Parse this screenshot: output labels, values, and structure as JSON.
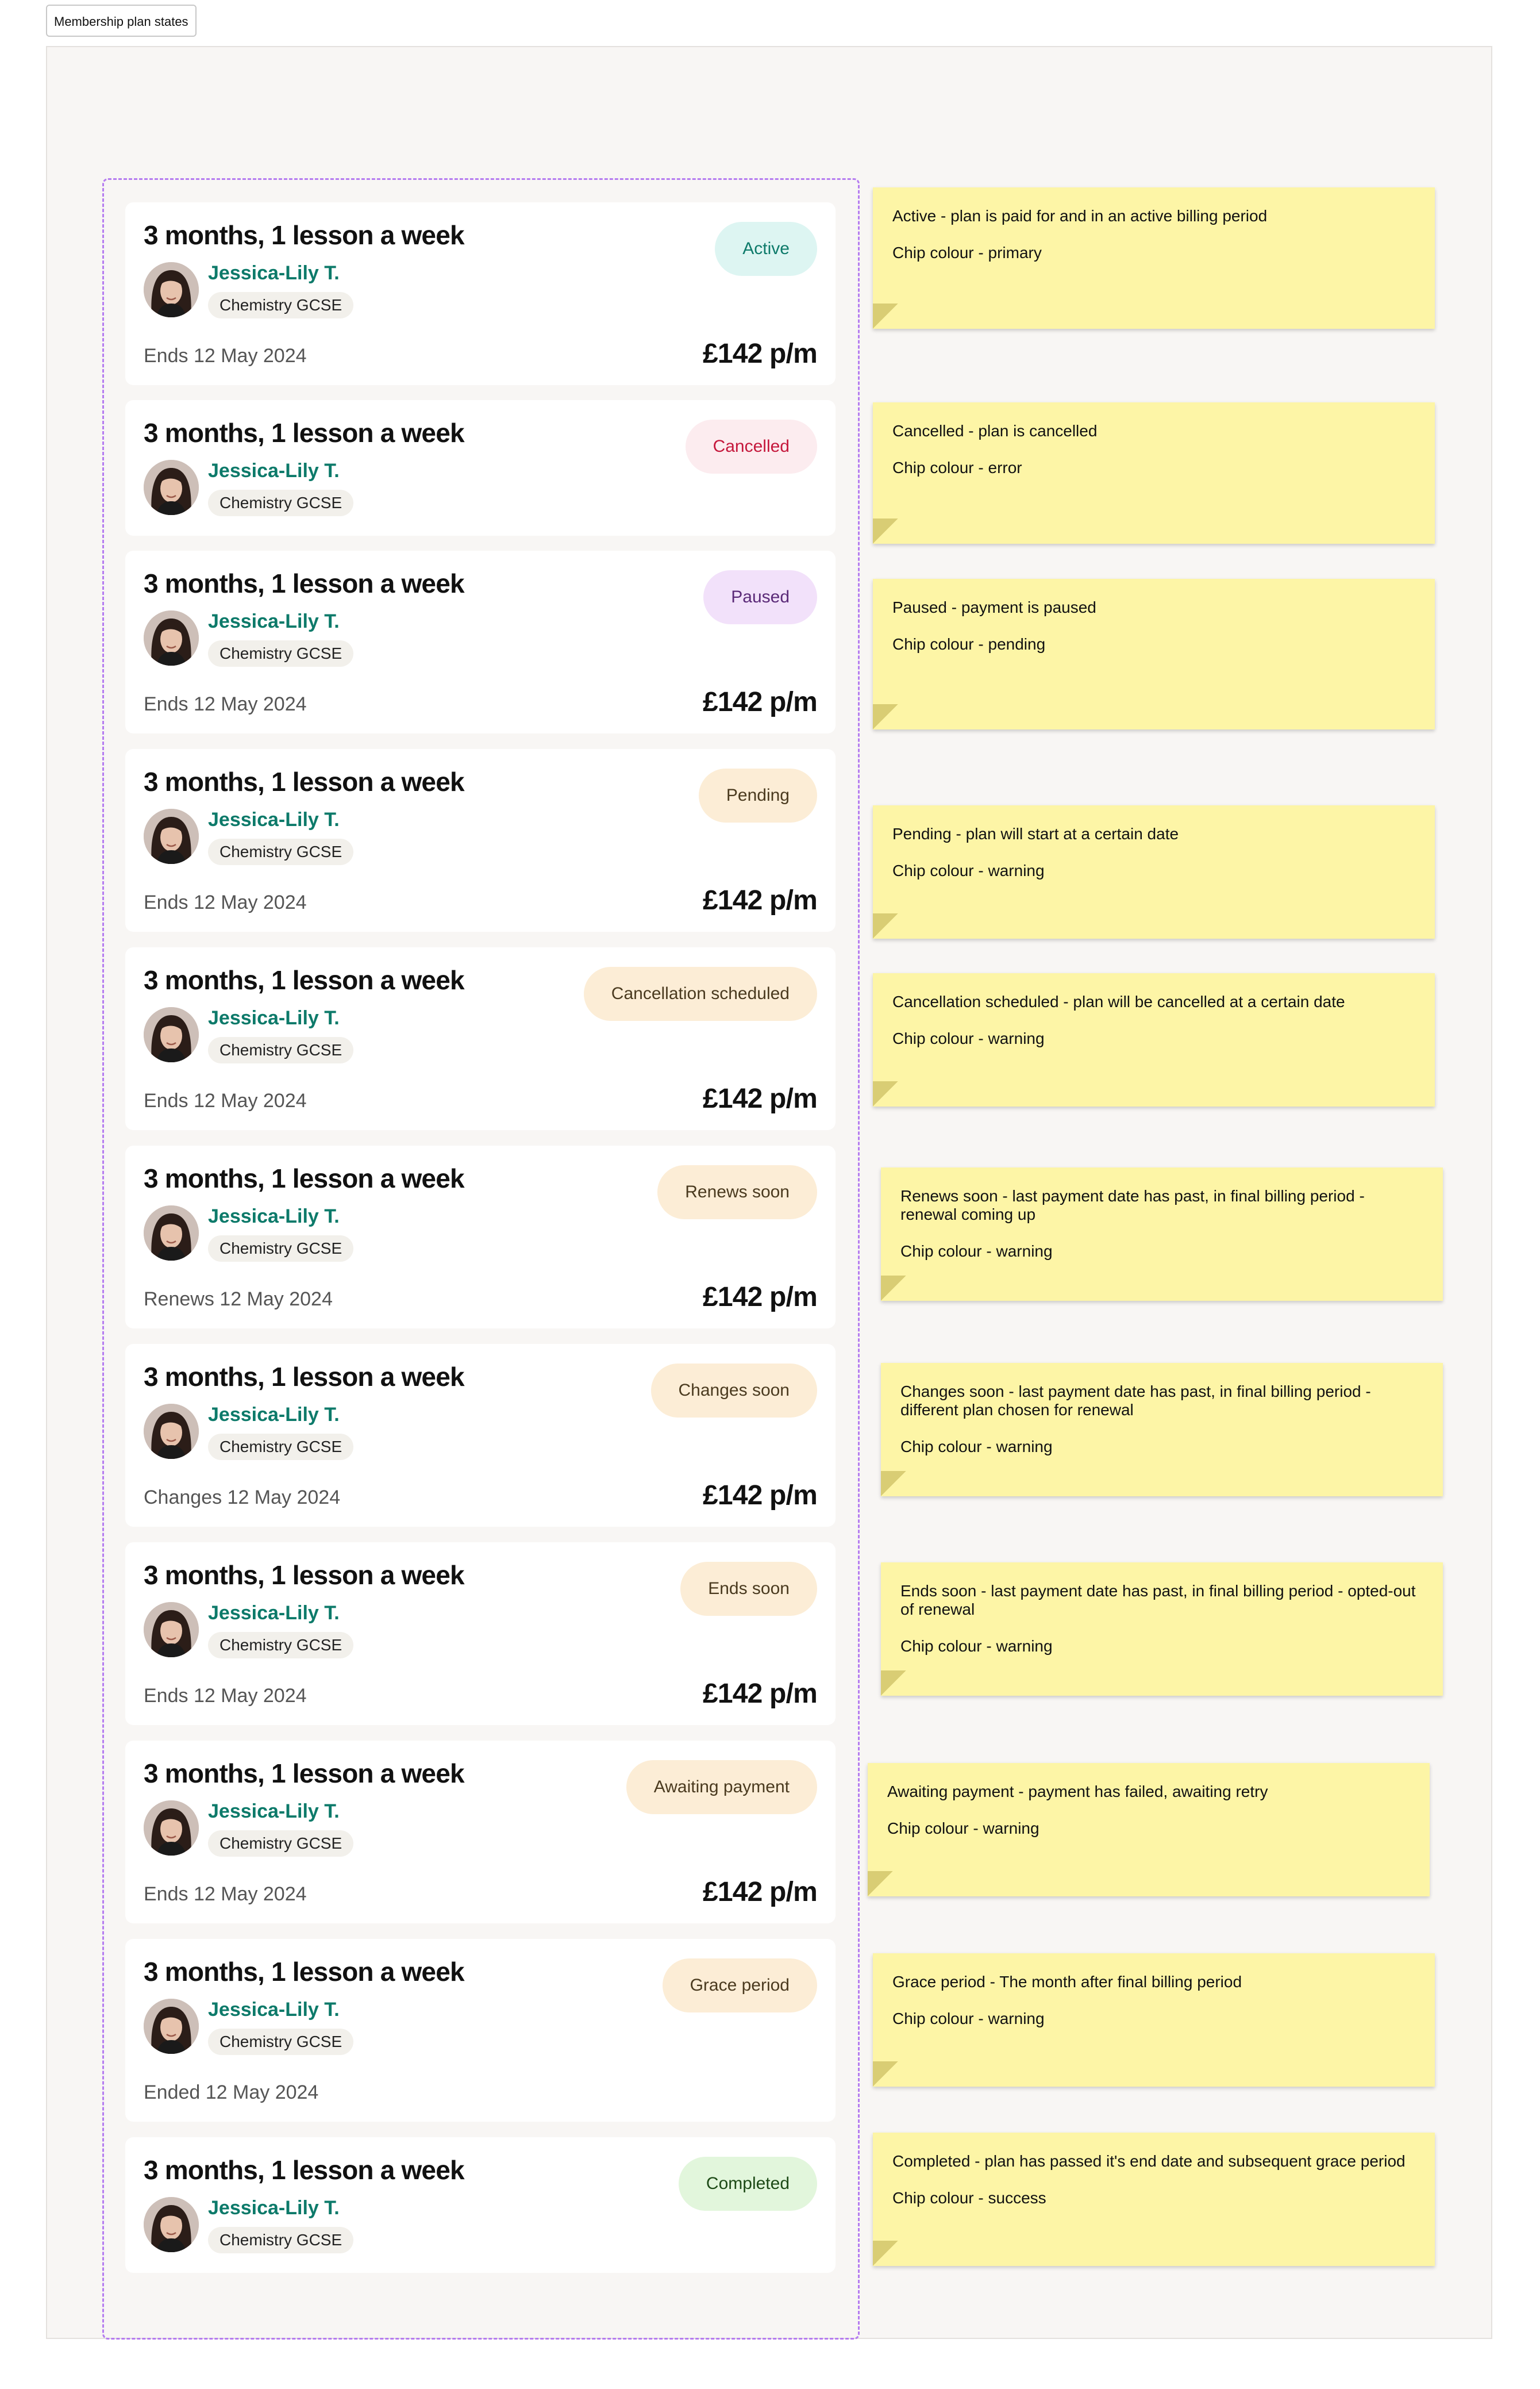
{
  "frame": {
    "label": "Membership plan states"
  },
  "colors": {
    "canvas_bg": "#f8f6f4",
    "dashed_border": "#b57cf0",
    "tutor_name": "#0d7a6a",
    "sticky_note": "#fdf5a6",
    "chip_primary": "#ddf5f2",
    "chip_error": "#fcecef",
    "chip_pending": "#f2e1fa",
    "chip_warning": "#fcedd6",
    "chip_success": "#e2f6dc"
  },
  "cards": [
    {
      "title": "3 months, 1 lesson a week",
      "tutor": "Jessica-Lily T.",
      "subject": "Chemistry GCSE",
      "status": "Active",
      "chip_color": "primary",
      "end_text": "Ends 12 May 2024",
      "price": "£142 p/m"
    },
    {
      "title": "3 months, 1 lesson a week",
      "tutor": "Jessica-Lily T.",
      "subject": "Chemistry GCSE",
      "status": "Cancelled",
      "chip_color": "error"
    },
    {
      "title": "3 months, 1 lesson a week",
      "tutor": "Jessica-Lily T.",
      "subject": "Chemistry GCSE",
      "status": "Paused",
      "chip_color": "pending",
      "end_text": "Ends 12 May 2024",
      "price": "£142 p/m"
    },
    {
      "title": "3 months, 1 lesson a week",
      "tutor": "Jessica-Lily T.",
      "subject": "Chemistry GCSE",
      "status": "Pending",
      "chip_color": "warning",
      "end_text": "Ends 12 May 2024",
      "price": "£142 p/m"
    },
    {
      "title": "3 months, 1 lesson a week",
      "tutor": "Jessica-Lily T.",
      "subject": "Chemistry GCSE",
      "status": "Cancellation scheduled",
      "chip_color": "warning",
      "end_text": "Ends 12 May 2024",
      "price": "£142 p/m"
    },
    {
      "title": "3 months, 1 lesson a week",
      "tutor": "Jessica-Lily T.",
      "subject": "Chemistry GCSE",
      "status": "Renews soon",
      "chip_color": "warning",
      "end_text": "Renews 12 May 2024",
      "price": "£142 p/m"
    },
    {
      "title": "3 months, 1 lesson a week",
      "tutor": "Jessica-Lily T.",
      "subject": "Chemistry GCSE",
      "status": "Changes soon",
      "chip_color": "warning",
      "end_text": "Changes 12 May 2024",
      "price": "£142 p/m"
    },
    {
      "title": "3 months, 1 lesson a week",
      "tutor": "Jessica-Lily T.",
      "subject": "Chemistry GCSE",
      "status": "Ends soon",
      "chip_color": "warning",
      "end_text": "Ends 12 May 2024",
      "price": "£142 p/m"
    },
    {
      "title": "3 months, 1 lesson a week",
      "tutor": "Jessica-Lily T.",
      "subject": "Chemistry GCSE",
      "status": "Awaiting payment",
      "chip_color": "warning",
      "end_text": "Ends 12 May 2024",
      "price": "£142 p/m"
    },
    {
      "title": "3 months, 1 lesson a week",
      "tutor": "Jessica-Lily T.",
      "subject": "Chemistry GCSE",
      "status": "Grace period",
      "chip_color": "warning",
      "end_text": "Ended 12 May 2024"
    },
    {
      "title": "3 months, 1 lesson a week",
      "tutor": "Jessica-Lily T.",
      "subject": "Chemistry GCSE",
      "status": "Completed",
      "chip_color": "success"
    }
  ],
  "notes": [
    {
      "description": "Active - plan is paid for and in an active billing period",
      "chip_text": "Chip colour - primary"
    },
    {
      "description": "Cancelled - plan is cancelled",
      "chip_text": "Chip colour - error"
    },
    {
      "description": "Paused - payment is paused",
      "chip_text": "Chip colour - pending"
    },
    {
      "description": "Pending - plan will start at a certain date",
      "chip_text": "Chip colour - warning"
    },
    {
      "description": "Cancellation scheduled - plan will be cancelled at a certain date",
      "chip_text": "Chip colour - warning"
    },
    {
      "description": "Renews soon - last payment date has past, in final billing period - renewal coming up",
      "chip_text": "Chip colour - warning"
    },
    {
      "description": "Changes soon - last payment date has past, in final billing period - different plan chosen for renewal",
      "chip_text": "Chip colour - warning"
    },
    {
      "description": "Ends soon - last payment date has past, in final billing period - opted-out of renewal",
      "chip_text": "Chip colour - warning"
    },
    {
      "description": "Awaiting payment - payment has failed, awaiting retry",
      "chip_text": "Chip colour - warning"
    },
    {
      "description": "Grace period - The month after final billing period",
      "chip_text": "Chip colour - warning"
    },
    {
      "description": "Completed - plan has passed it's end date and subsequent grace period",
      "chip_text": "Chip colour - success"
    }
  ]
}
